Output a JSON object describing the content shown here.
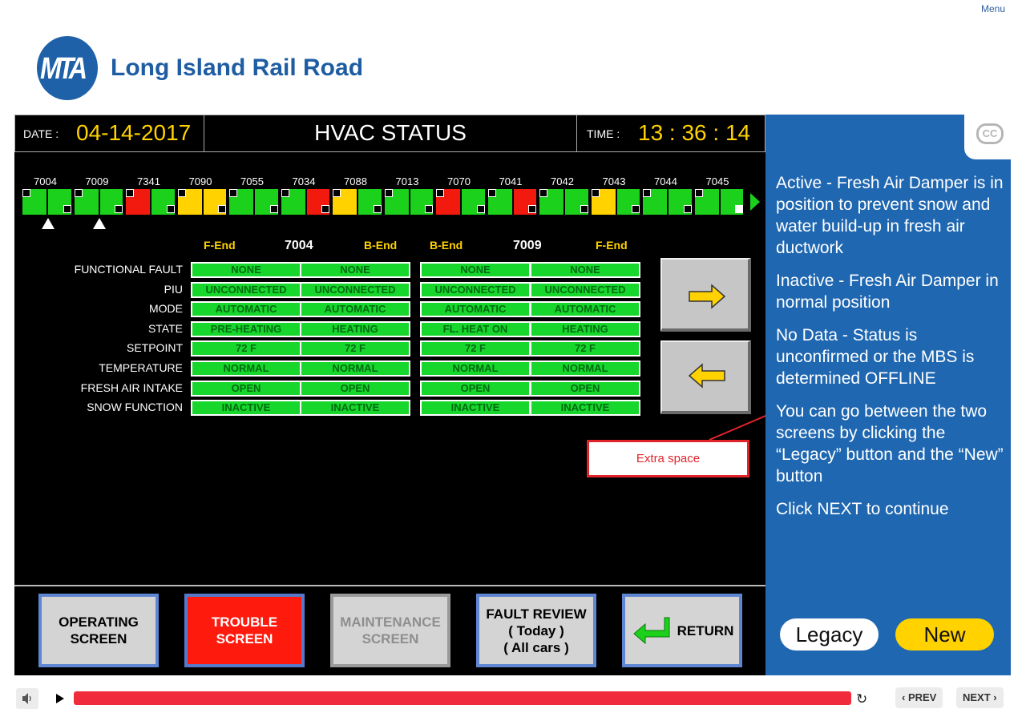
{
  "menu_label": "Menu",
  "brand": {
    "logo_text": "MTA",
    "title": "Long Island Rail Road"
  },
  "header": {
    "date_label": "DATE :",
    "date_value": "04-14-2017",
    "title": "HVAC STATUS",
    "time_label": "TIME :",
    "time_value": "13 : 36 : 14"
  },
  "car_numbers": [
    "7004",
    "7009",
    "7341",
    "7090",
    "7055",
    "7034",
    "7088",
    "7013",
    "7070",
    "7041",
    "7042",
    "7043",
    "7044",
    "7045"
  ],
  "train_colors": {
    "green": "#1bd11b",
    "red": "#f21a0e",
    "yellow": "#ffd200"
  },
  "train_segments": [
    [
      "green",
      "green"
    ],
    [
      "green",
      "green"
    ],
    [
      "red",
      "green"
    ],
    [
      "yellow",
      "yellow"
    ],
    [
      "green",
      "green"
    ],
    [
      "green",
      "red"
    ],
    [
      "yellow",
      "green"
    ],
    [
      "green",
      "green"
    ],
    [
      "red",
      "green"
    ],
    [
      "green",
      "red"
    ],
    [
      "green",
      "green"
    ],
    [
      "yellow",
      "green"
    ],
    [
      "green",
      "green"
    ],
    [
      "green",
      "green"
    ]
  ],
  "cars_selected": {
    "left": {
      "number": "7004",
      "end_a": "F-End",
      "end_b": "B-End"
    },
    "right": {
      "number": "7009",
      "end_a": "B-End",
      "end_b": "F-End"
    }
  },
  "status_rows": [
    {
      "label": "FUNCTIONAL FAULT",
      "values": [
        "NONE",
        "NONE",
        "NONE",
        "NONE"
      ]
    },
    {
      "label": "PIU",
      "values": [
        "UNCONNECTED",
        "UNCONNECTED",
        "UNCONNECTED",
        "UNCONNECTED"
      ]
    },
    {
      "label": "MODE",
      "values": [
        "AUTOMATIC",
        "AUTOMATIC",
        "AUTOMATIC",
        "AUTOMATIC"
      ]
    },
    {
      "label": "STATE",
      "values": [
        "PRE-HEATING",
        "HEATING",
        "FL. HEAT ON",
        "HEATING"
      ]
    },
    {
      "label": "SETPOINT",
      "values": [
        "72 F",
        "72 F",
        "72 F",
        "72 F"
      ]
    },
    {
      "label": "TEMPERATURE",
      "values": [
        "NORMAL",
        "NORMAL",
        "NORMAL",
        "NORMAL"
      ]
    },
    {
      "label": "FRESH AIR INTAKE",
      "values": [
        "OPEN",
        "OPEN",
        "OPEN",
        "OPEN"
      ]
    },
    {
      "label": "SNOW FUNCTION",
      "values": [
        "INACTIVE",
        "INACTIVE",
        "INACTIVE",
        "INACTIVE"
      ]
    }
  ],
  "function_buttons": [
    {
      "line1": "OPERATING",
      "line2": "SCREEN",
      "line3": ""
    },
    {
      "line1": "TROUBLE",
      "line2": "SCREEN",
      "line3": ""
    },
    {
      "line1": "MAINTENANCE",
      "line2": "SCREEN",
      "line3": ""
    },
    {
      "line1": "FAULT REVIEW",
      "line2": "( Today )",
      "line3": "( All cars )"
    },
    {
      "line1": "RETURN",
      "line2": "",
      "line3": ""
    }
  ],
  "callout_text": "Extra space",
  "sidebar": {
    "cc_label": "CC",
    "paragraphs": [
      "Active - Fresh Air Damper is in position to prevent snow and water build-up in fresh air ductwork",
      "Inactive - Fresh Air Damper in normal position",
      "No Data - Status is unconfirmed or the MBS is determined OFFLINE",
      "You can go between the two screens by clicking the “Legacy” button and the “New” button",
      "Click NEXT to continue"
    ],
    "legacy_label": "Legacy",
    "new_label": "New"
  },
  "player": {
    "progress_fraction": 1.0,
    "prev_label": "PREV",
    "next_label": "NEXT"
  }
}
